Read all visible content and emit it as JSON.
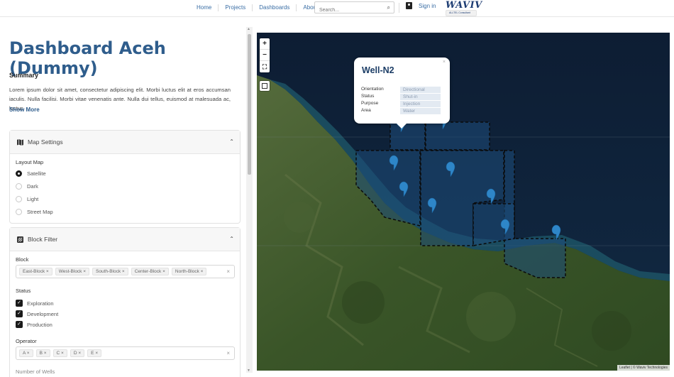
{
  "nav": {
    "links": [
      "Home",
      "Projects",
      "Dashboards",
      "About"
    ],
    "search_placeholder": "Search...",
    "signin": "Sign in",
    "logo": "WAVIV",
    "logo_tag": "ALLTEL Consultant"
  },
  "page": {
    "title": "Dashboard Aceh (Dummy)",
    "summary_heading": "Summary",
    "summary_text": "Lorem ipsum dolor sit amet, consectetur adipiscing elit. Morbi luctus elit at eros accumsan iaculis. Nulla facilisi. Morbi vitae venenatis ante. Nulla dui tellus, euismod at malesuada ac, luctus",
    "show_more": "Show More"
  },
  "map_settings": {
    "title": "Map Settings",
    "layout_label": "Layout Map",
    "options": [
      "Satellite",
      "Dark",
      "Light",
      "Street Map"
    ],
    "selected": "Satellite"
  },
  "block_filter": {
    "title": "Block Filter",
    "block_label": "Block",
    "blocks": [
      "East-Block",
      "West-Block",
      "South-Block",
      "Center-Block",
      "North-Block"
    ],
    "status_label": "Status",
    "statuses": [
      "Exploration",
      "Development",
      "Production"
    ],
    "operator_label": "Operator",
    "operators": [
      "A",
      "B",
      "C",
      "D",
      "E"
    ],
    "next_label": "Number of Wells"
  },
  "map": {
    "zoom_in": "+",
    "zoom_out": "−",
    "fullscreen": "⛶",
    "attribution": "Leaflet | © Waviv Technologies",
    "popup": {
      "title": "Well-N2",
      "close": "×",
      "fields": [
        {
          "key": "Orientation",
          "value": "Directional"
        },
        {
          "key": "Status",
          "value": "Shut-in"
        },
        {
          "key": "Purpose",
          "value": "Injection"
        },
        {
          "key": "Area",
          "value": "Water"
        }
      ]
    },
    "colors": {
      "land": "#3f5a2c",
      "sea": "#0f2238",
      "block_fill": "#1e4d7a",
      "marker": "#2e86c8"
    }
  }
}
